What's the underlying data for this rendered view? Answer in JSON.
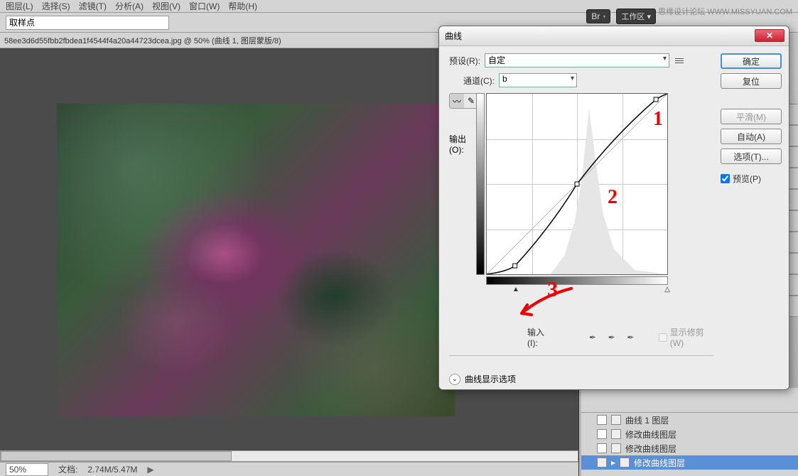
{
  "menubar": {
    "items": [
      "图层(L)",
      "选择(S)",
      "滤镜(T)",
      "分析(A)",
      "视图(V)",
      "窗口(W)",
      "帮助(H)"
    ]
  },
  "optbar": {
    "sample_point_label": "取样点"
  },
  "workspace": {
    "br_label": "Br",
    "ws_label": "工作区 ▾"
  },
  "watermark": {
    "text": "思缘设计论坛 WWW.MISSYUAN.COM"
  },
  "doc": {
    "tab": "58ee3d6d55fbb2fbdea1f4544f4a20a44723dcea.jpg @ 50% (曲线 1, 图层蒙版/8)"
  },
  "status": {
    "zoom": "50%",
    "doc_label": "文档:",
    "doc_size": "2.74M/5.47M"
  },
  "history": {
    "items": [
      {
        "label": "曲线 1 图层",
        "sel": false
      },
      {
        "label": "修改曲线图层",
        "sel": false
      },
      {
        "label": "修改曲线图层",
        "sel": false
      },
      {
        "label": "修改曲线图层",
        "sel": true
      }
    ]
  },
  "dialog": {
    "title": "曲线",
    "preset_label": "预设(R):",
    "preset_value": "自定",
    "channel_label": "通道(C):",
    "channel_value": "b",
    "output_label": "输出(O):",
    "input_label": "输入(I):",
    "show_clip_label": "显示修剪(W)",
    "expand_label": "曲线显示选项",
    "annotations": {
      "a1": "1",
      "a2": "2",
      "a3": "3"
    },
    "buttons": {
      "ok": "确定",
      "reset": "复位",
      "smooth": "平滑(M)",
      "auto": "自动(A)",
      "options": "选项(T)...",
      "preview": "预览(P)"
    }
  },
  "chart_data": {
    "type": "line",
    "title": "曲线 (Curves) — 通道 b",
    "xlabel": "输入",
    "ylabel": "输出",
    "xlim": [
      0,
      255
    ],
    "ylim": [
      0,
      255
    ],
    "series": [
      {
        "name": "baseline",
        "x": [
          0,
          255
        ],
        "y": [
          0,
          255
        ]
      },
      {
        "name": "curve",
        "x": [
          0,
          40,
          128,
          240,
          255
        ],
        "y": [
          0,
          12,
          128,
          248,
          255
        ]
      }
    ],
    "control_points": [
      {
        "x": 40,
        "y": 12
      },
      {
        "x": 128,
        "y": 128
      },
      {
        "x": 240,
        "y": 248
      }
    ],
    "histogram_peak_x": 145
  }
}
